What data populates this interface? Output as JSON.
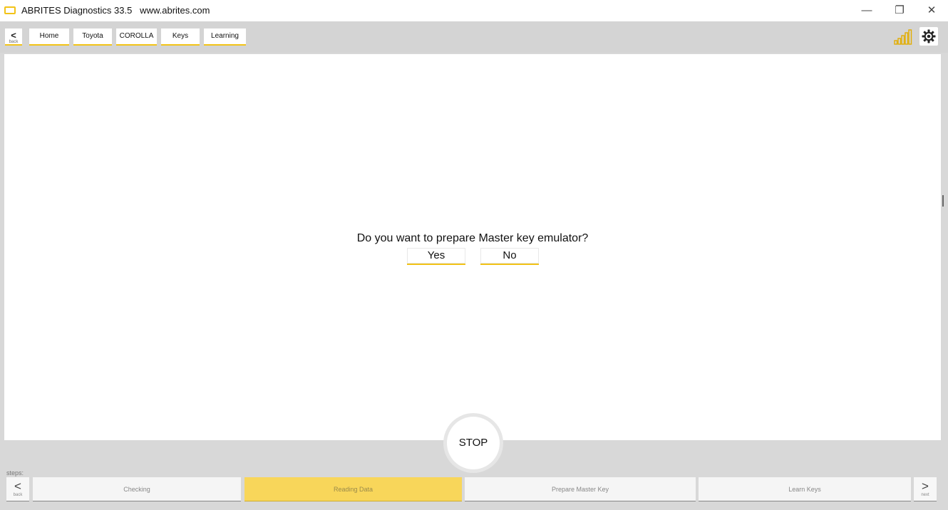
{
  "window": {
    "title": "ABRITES Diagnostics 33.5   www.abrites.com",
    "minimize_glyph": "—",
    "restore_glyph": "❐",
    "close_glyph": "✕"
  },
  "nav": {
    "back_arrow": "<",
    "back_label": "back",
    "breadcrumbs": [
      "Home",
      "Toyota",
      "COROLLA",
      "Keys",
      "Learning"
    ],
    "signal_icon": "signal-strength-icon",
    "settings_icon": "gear-icon",
    "accent_color": "#f2c318"
  },
  "dialog": {
    "question": "Do you want to prepare Master key emulator?",
    "yes_label": "Yes",
    "no_label": "No"
  },
  "stop": {
    "label": "STOP"
  },
  "steps": {
    "label": "steps:",
    "back_arrow": "<",
    "back_label": "back",
    "next_arrow": ">",
    "next_label": "next",
    "items": [
      {
        "label": "Checking",
        "active": false
      },
      {
        "label": "Reading Data",
        "active": true
      },
      {
        "label": "Prepare Master Key",
        "active": false
      },
      {
        "label": "Learn Keys",
        "active": false
      }
    ],
    "active_color": "#f8d65a"
  }
}
